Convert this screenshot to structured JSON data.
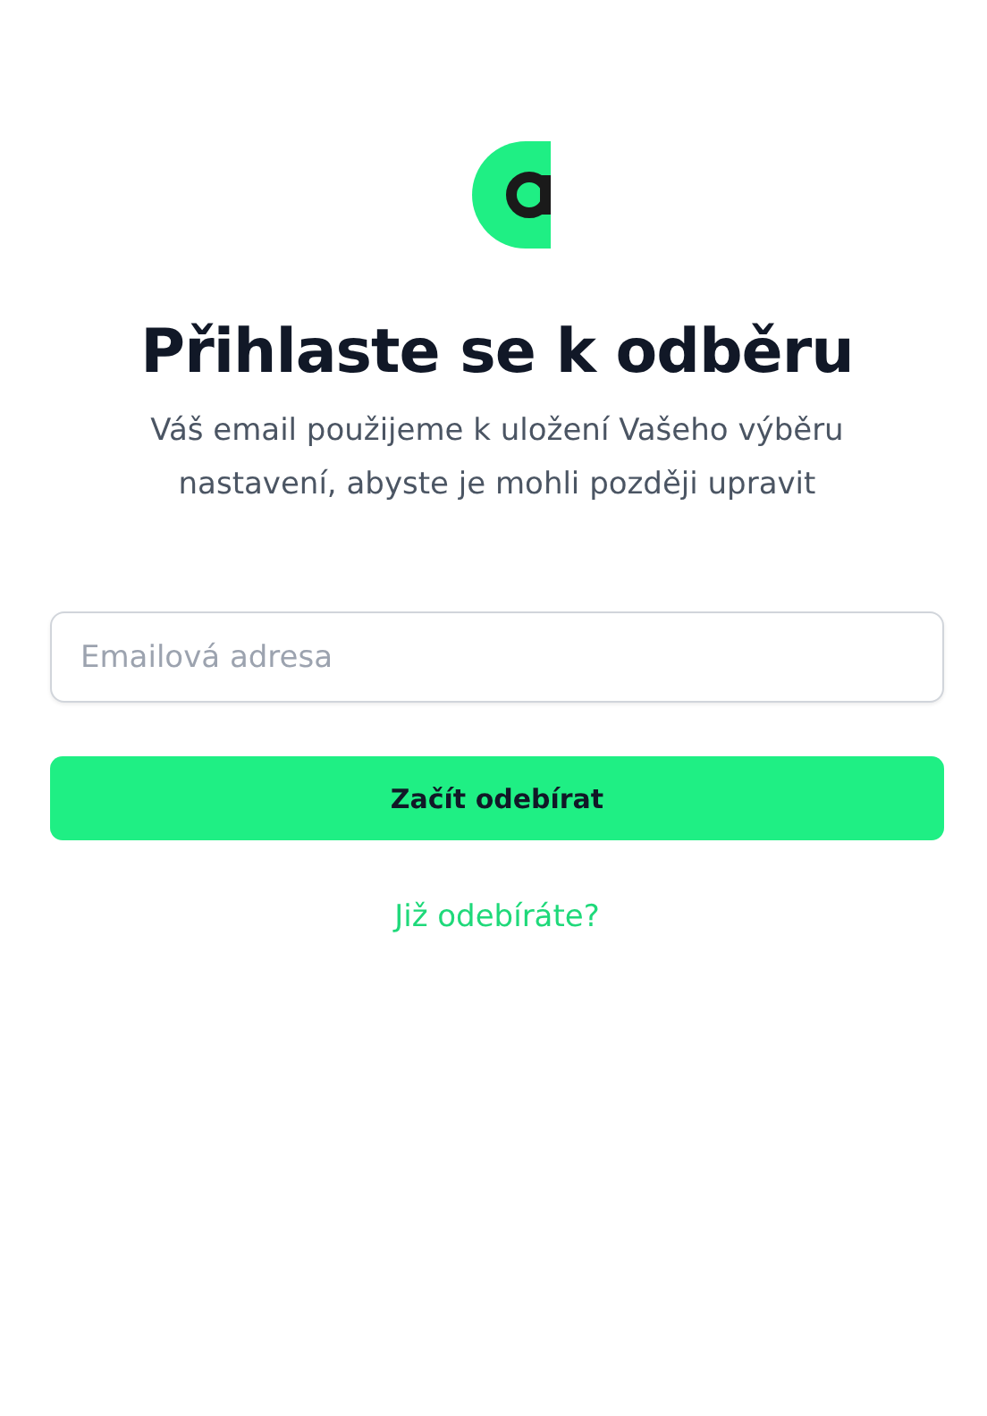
{
  "title": "Přihlaste se k odběru",
  "subtitle": "Váš email použijeme k uložení Vašeho výběru nastavení, abyste je mohli později upravit",
  "email": {
    "placeholder": "Emailová adresa"
  },
  "submit": "Začít odebírat",
  "link": "Již odebíráte?"
}
